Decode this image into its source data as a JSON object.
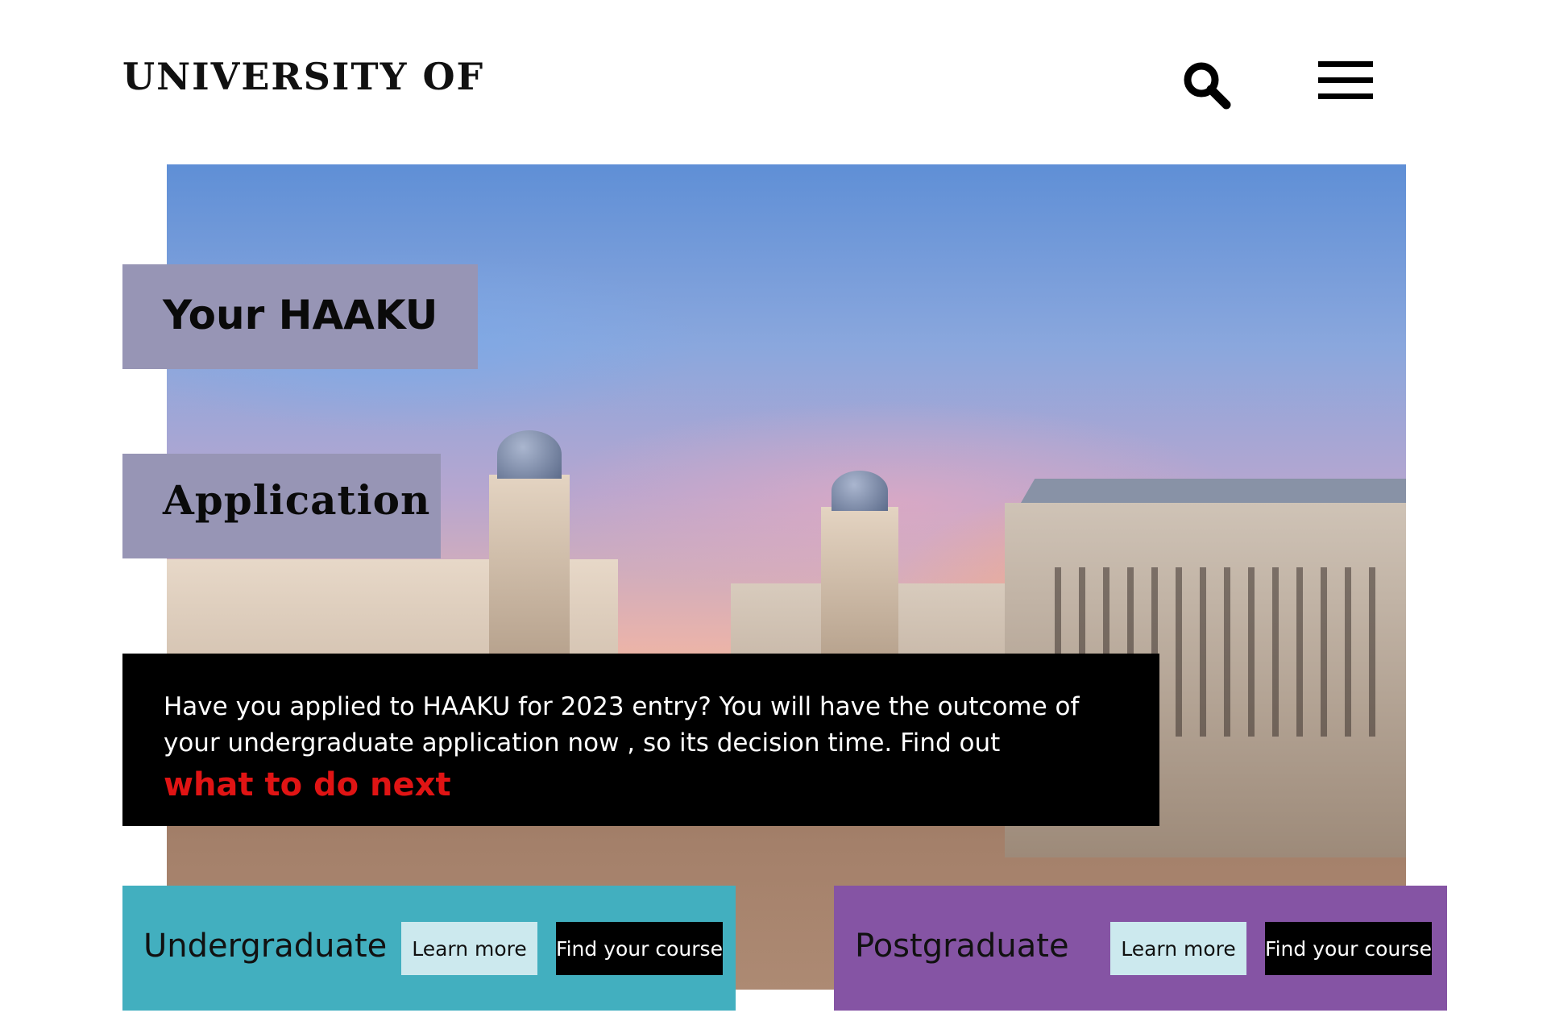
{
  "header": {
    "brand": "UNIVERSITY OF",
    "search_icon": "search-icon",
    "menu_icon": "hamburger-menu-icon"
  },
  "hero": {
    "title_line1": "Your HAAKU",
    "title_line2": "Application",
    "message": "Have you applied to HAAKU for 2023 entry? You will have the outcome of your undergraduate application now , so its decision time. Find out",
    "link_text": "what to do next"
  },
  "panels": {
    "undergraduate": {
      "label": "Undergraduate",
      "learn_more": "Learn more",
      "find_course": "Find your course"
    },
    "postgraduate": {
      "label": "Postgraduate",
      "learn_more": "Learn more",
      "find_course": "Find your course"
    }
  },
  "colors": {
    "title_bg": "#9795b5",
    "message_bg": "#000000",
    "link": "#e01414",
    "undergraduate_bg": "#42afbf",
    "postgraduate_bg": "#8554a4",
    "learn_more_bg": "#cce9ee"
  }
}
